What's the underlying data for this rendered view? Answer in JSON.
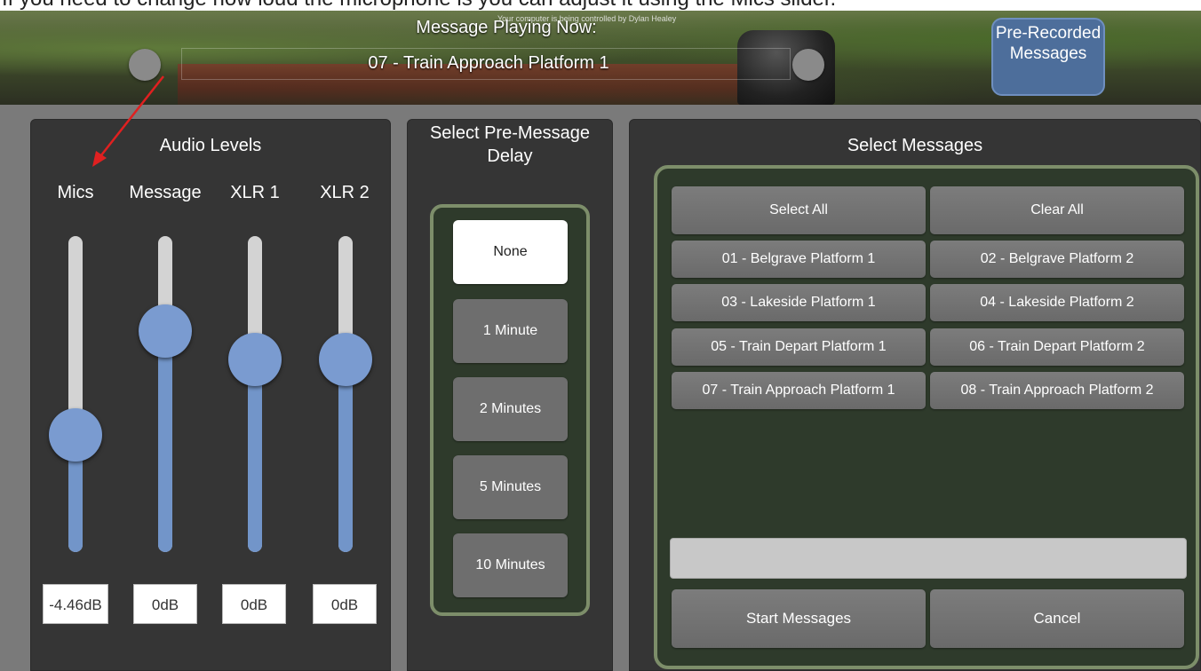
{
  "instruction": "If you need to change how loud the microphone is you can adjust it using the Mics slider.",
  "header": {
    "now_playing_title": "Message Playing Now:",
    "now_playing_value": "07 - Train Approach Platform 1",
    "control_notice": "Your computer is being controlled by Dylan Healey",
    "prerecorded_button": "Pre-Recorded Messages"
  },
  "audio": {
    "title": "Audio Levels",
    "channels": [
      {
        "label": "Mics",
        "db": "-4.46dB",
        "level": 0.37
      },
      {
        "label": "Message",
        "db": "0dB",
        "level": 0.7
      },
      {
        "label": "XLR 1",
        "db": "0dB",
        "level": 0.61
      },
      {
        "label": "XLR 2",
        "db": "0dB",
        "level": 0.61
      }
    ]
  },
  "delay": {
    "title": "Select Pre-Message Delay",
    "options": [
      "None",
      "1 Minute",
      "2 Minutes",
      "5 Minutes",
      "10 Minutes"
    ],
    "selected": "None"
  },
  "messages": {
    "title": "Select Messages",
    "select_all": "Select All",
    "clear_all": "Clear All",
    "items": [
      "01 - Belgrave Platform 1",
      "02 - Belgrave Platform 2",
      "03 - Lakeside Platform 1",
      "04 - Lakeside Platform 2",
      "05 - Train Depart Platform 1",
      "06 - Train Depart Platform 2",
      "07 - Train Approach Platform 1",
      "08 - Train Approach Platform 2"
    ],
    "input_value": "",
    "start_button": "Start Messages",
    "cancel_button": "Cancel"
  },
  "colors": {
    "accent_blue": "#7a9bd0",
    "group_border": "#7d8e6a",
    "panel_bg": "#353535",
    "annotation_arrow": "#e02020"
  }
}
